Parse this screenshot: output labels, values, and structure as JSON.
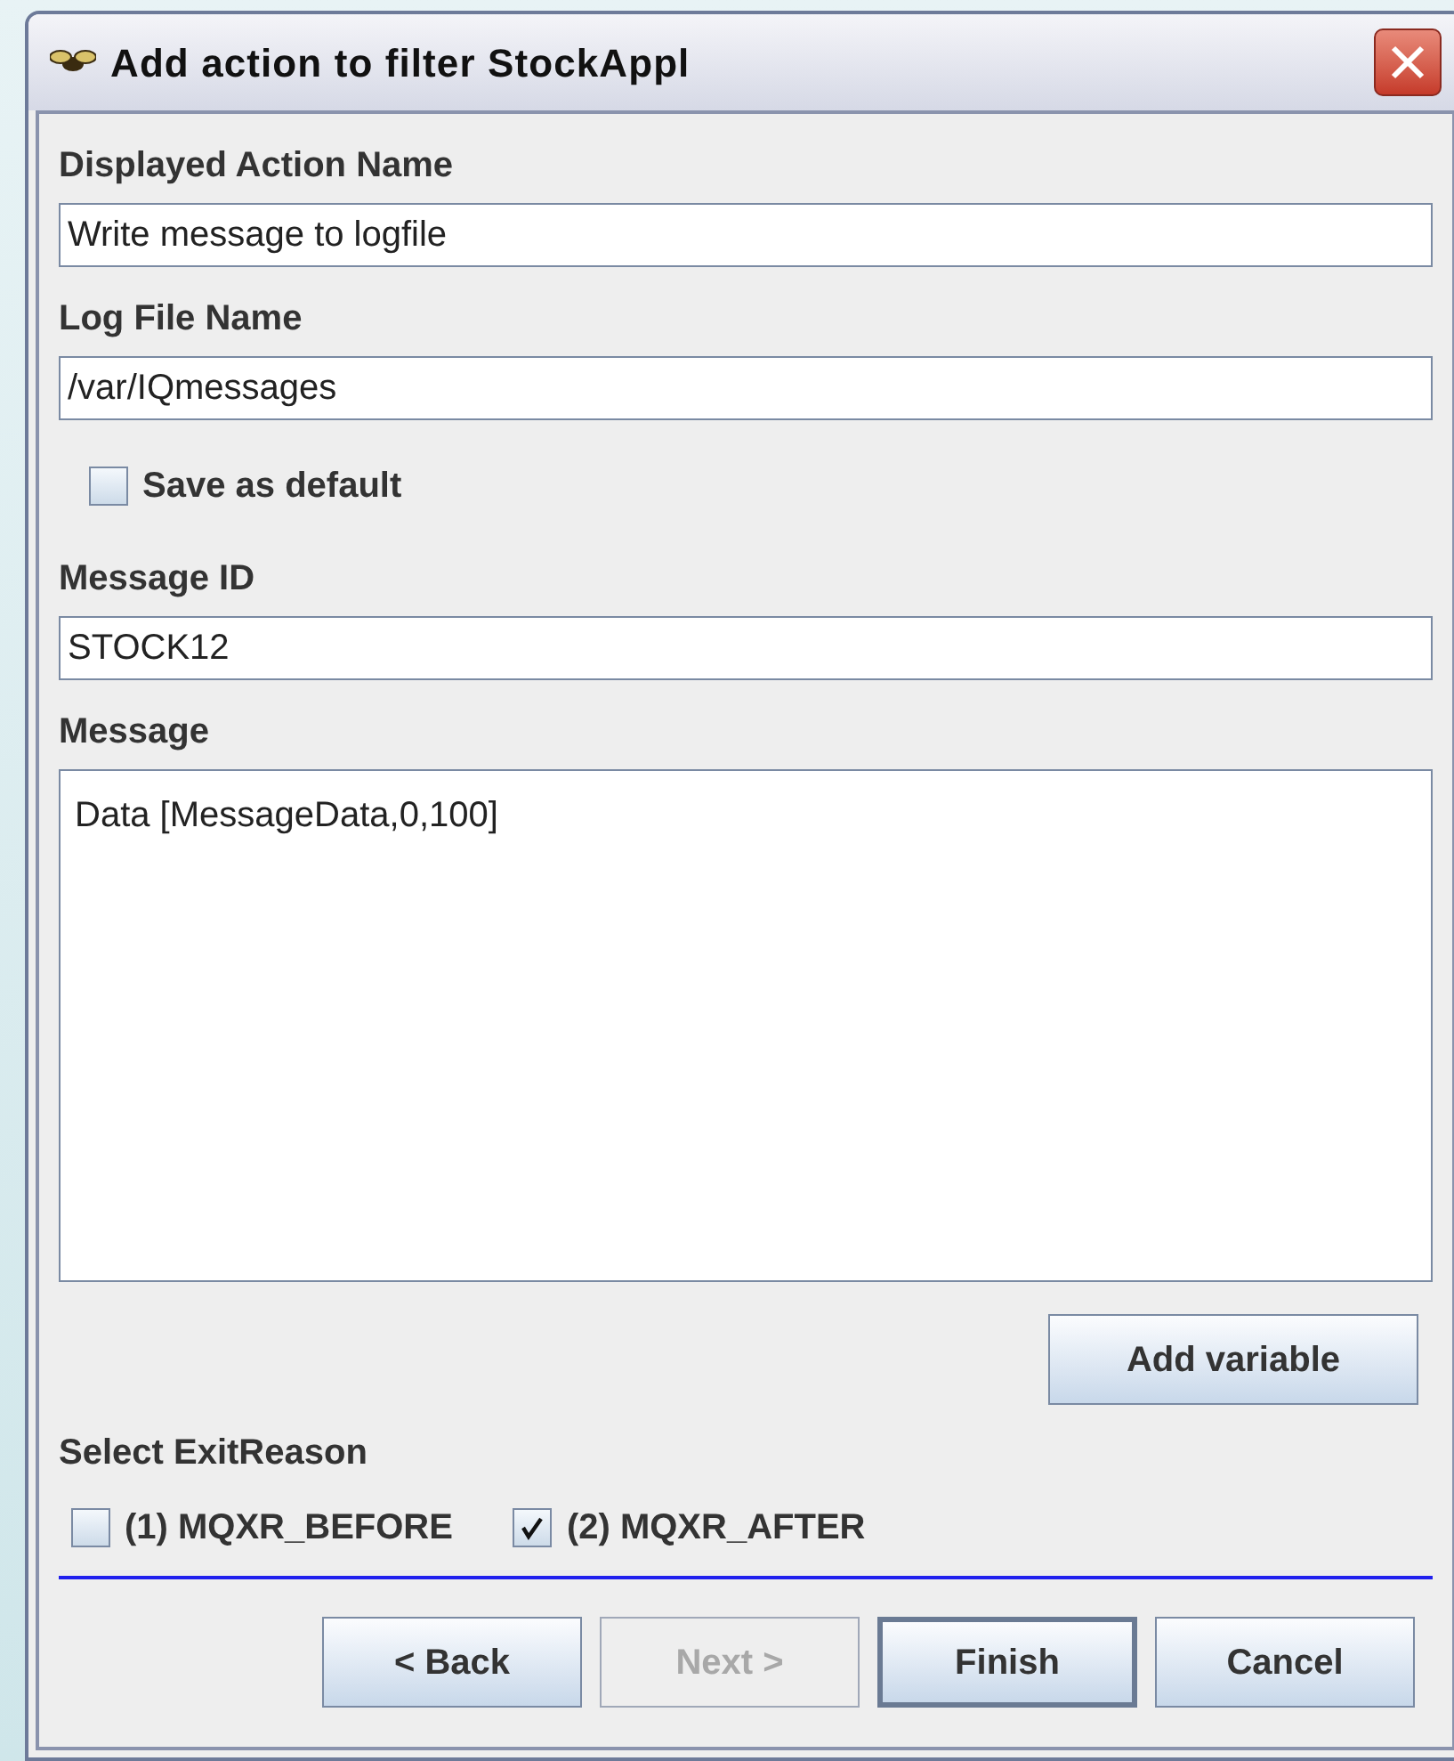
{
  "window": {
    "title": "Add action to filter StockAppl"
  },
  "fields": [
    {
      "label": "Displayed Action Name",
      "value": "Write message to logfile"
    },
    {
      "label": "Log File Name",
      "value": "/var/IQmessages"
    }
  ],
  "save_default": {
    "label": "Save as default",
    "checked": false
  },
  "message_id": {
    "label": "Message ID",
    "value": "STOCK12"
  },
  "message": {
    "label": "Message",
    "value": "Data [MessageData,0,100]"
  },
  "add_variable": {
    "label": "Add variable"
  },
  "exit_reason": {
    "label": "Select ExitReason",
    "options": [
      {
        "label": "(1) MQXR_BEFORE",
        "checked": false
      },
      {
        "label": "(2) MQXR_AFTER",
        "checked": true
      }
    ]
  },
  "buttons": [
    {
      "label": "< Back",
      "disabled": false,
      "default": false
    },
    {
      "label": "Next >",
      "disabled": true,
      "default": false
    },
    {
      "label": "Finish",
      "disabled": false,
      "default": true
    },
    {
      "label": "Cancel",
      "disabled": false,
      "default": false
    }
  ]
}
